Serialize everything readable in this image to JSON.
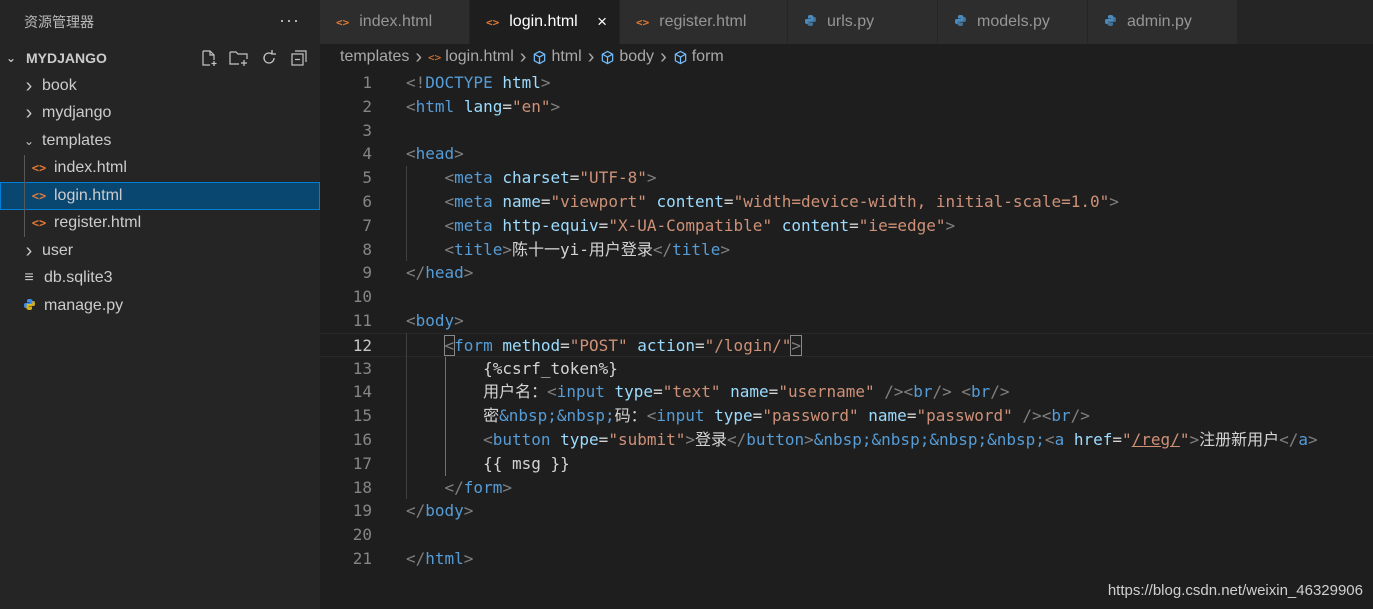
{
  "sidebar": {
    "title": "资源管理器",
    "more_icon": "ellipsis-icon",
    "section": "MYDJANGO",
    "actions": [
      "new-file-icon",
      "new-folder-icon",
      "refresh-icon",
      "collapse-all-icon"
    ],
    "items": [
      {
        "label": "book",
        "type": "folder",
        "expanded": false
      },
      {
        "label": "mydjango",
        "type": "folder",
        "expanded": false
      },
      {
        "label": "templates",
        "type": "folder",
        "expanded": true
      },
      {
        "label": "index.html",
        "type": "html"
      },
      {
        "label": "login.html",
        "type": "html",
        "selected": true
      },
      {
        "label": "register.html",
        "type": "html"
      },
      {
        "label": "user",
        "type": "folder",
        "expanded": false
      },
      {
        "label": "db.sqlite3",
        "type": "db"
      },
      {
        "label": "manage.py",
        "type": "py"
      }
    ]
  },
  "tabs": [
    {
      "label": "index.html",
      "icon": "html-file-icon"
    },
    {
      "label": "login.html",
      "icon": "html-file-icon",
      "active": true,
      "close": "×"
    },
    {
      "label": "register.html",
      "icon": "html-file-icon"
    },
    {
      "label": "urls.py",
      "icon": "python-file-icon"
    },
    {
      "label": "models.py",
      "icon": "python-file-icon"
    },
    {
      "label": "admin.py",
      "icon": "python-file-icon"
    }
  ],
  "breadcrumb": [
    "templates",
    "login.html",
    "html",
    "body",
    "form"
  ],
  "editor": {
    "current_line": 12,
    "lines": [
      {
        "n": "1",
        "text": "<!DOCTYPE html>"
      },
      {
        "n": "2",
        "text": "<html lang=\"en\">"
      },
      {
        "n": "3",
        "text": ""
      },
      {
        "n": "4",
        "text": "<head>"
      },
      {
        "n": "5",
        "text": "    <meta charset=\"UTF-8\">"
      },
      {
        "n": "6",
        "text": "    <meta name=\"viewport\" content=\"width=device-width, initial-scale=1.0\">"
      },
      {
        "n": "7",
        "text": "    <meta http-equiv=\"X-UA-Compatible\" content=\"ie=edge\">"
      },
      {
        "n": "8",
        "text": "    <title>陈十一yi-用户登录</title>"
      },
      {
        "n": "9",
        "text": "</head>"
      },
      {
        "n": "10",
        "text": ""
      },
      {
        "n": "11",
        "text": "<body>"
      },
      {
        "n": "12",
        "text": "    <form method=\"POST\" action=\"/login/\">"
      },
      {
        "n": "13",
        "text": "        {%csrf_token%}"
      },
      {
        "n": "14",
        "text": "        用户名：<input type=\"text\" name=\"username\" /><br/> <br/>"
      },
      {
        "n": "15",
        "text": "        密&nbsp;&nbsp;码：<input type=\"password\" name=\"password\" /><br/>"
      },
      {
        "n": "16",
        "text": "        <button type=\"submit\">登录</button>&nbsp;&nbsp;&nbsp;&nbsp;<a href=\"/reg/\">注册新用户</a>"
      },
      {
        "n": "17",
        "text": "        {{ msg }}"
      },
      {
        "n": "18",
        "text": "    </form>"
      },
      {
        "n": "19",
        "text": "</body>"
      },
      {
        "n": "20",
        "text": ""
      },
      {
        "n": "21",
        "text": "</html>"
      }
    ]
  },
  "watermark": "https://blog.csdn.net/weixin_46329906"
}
